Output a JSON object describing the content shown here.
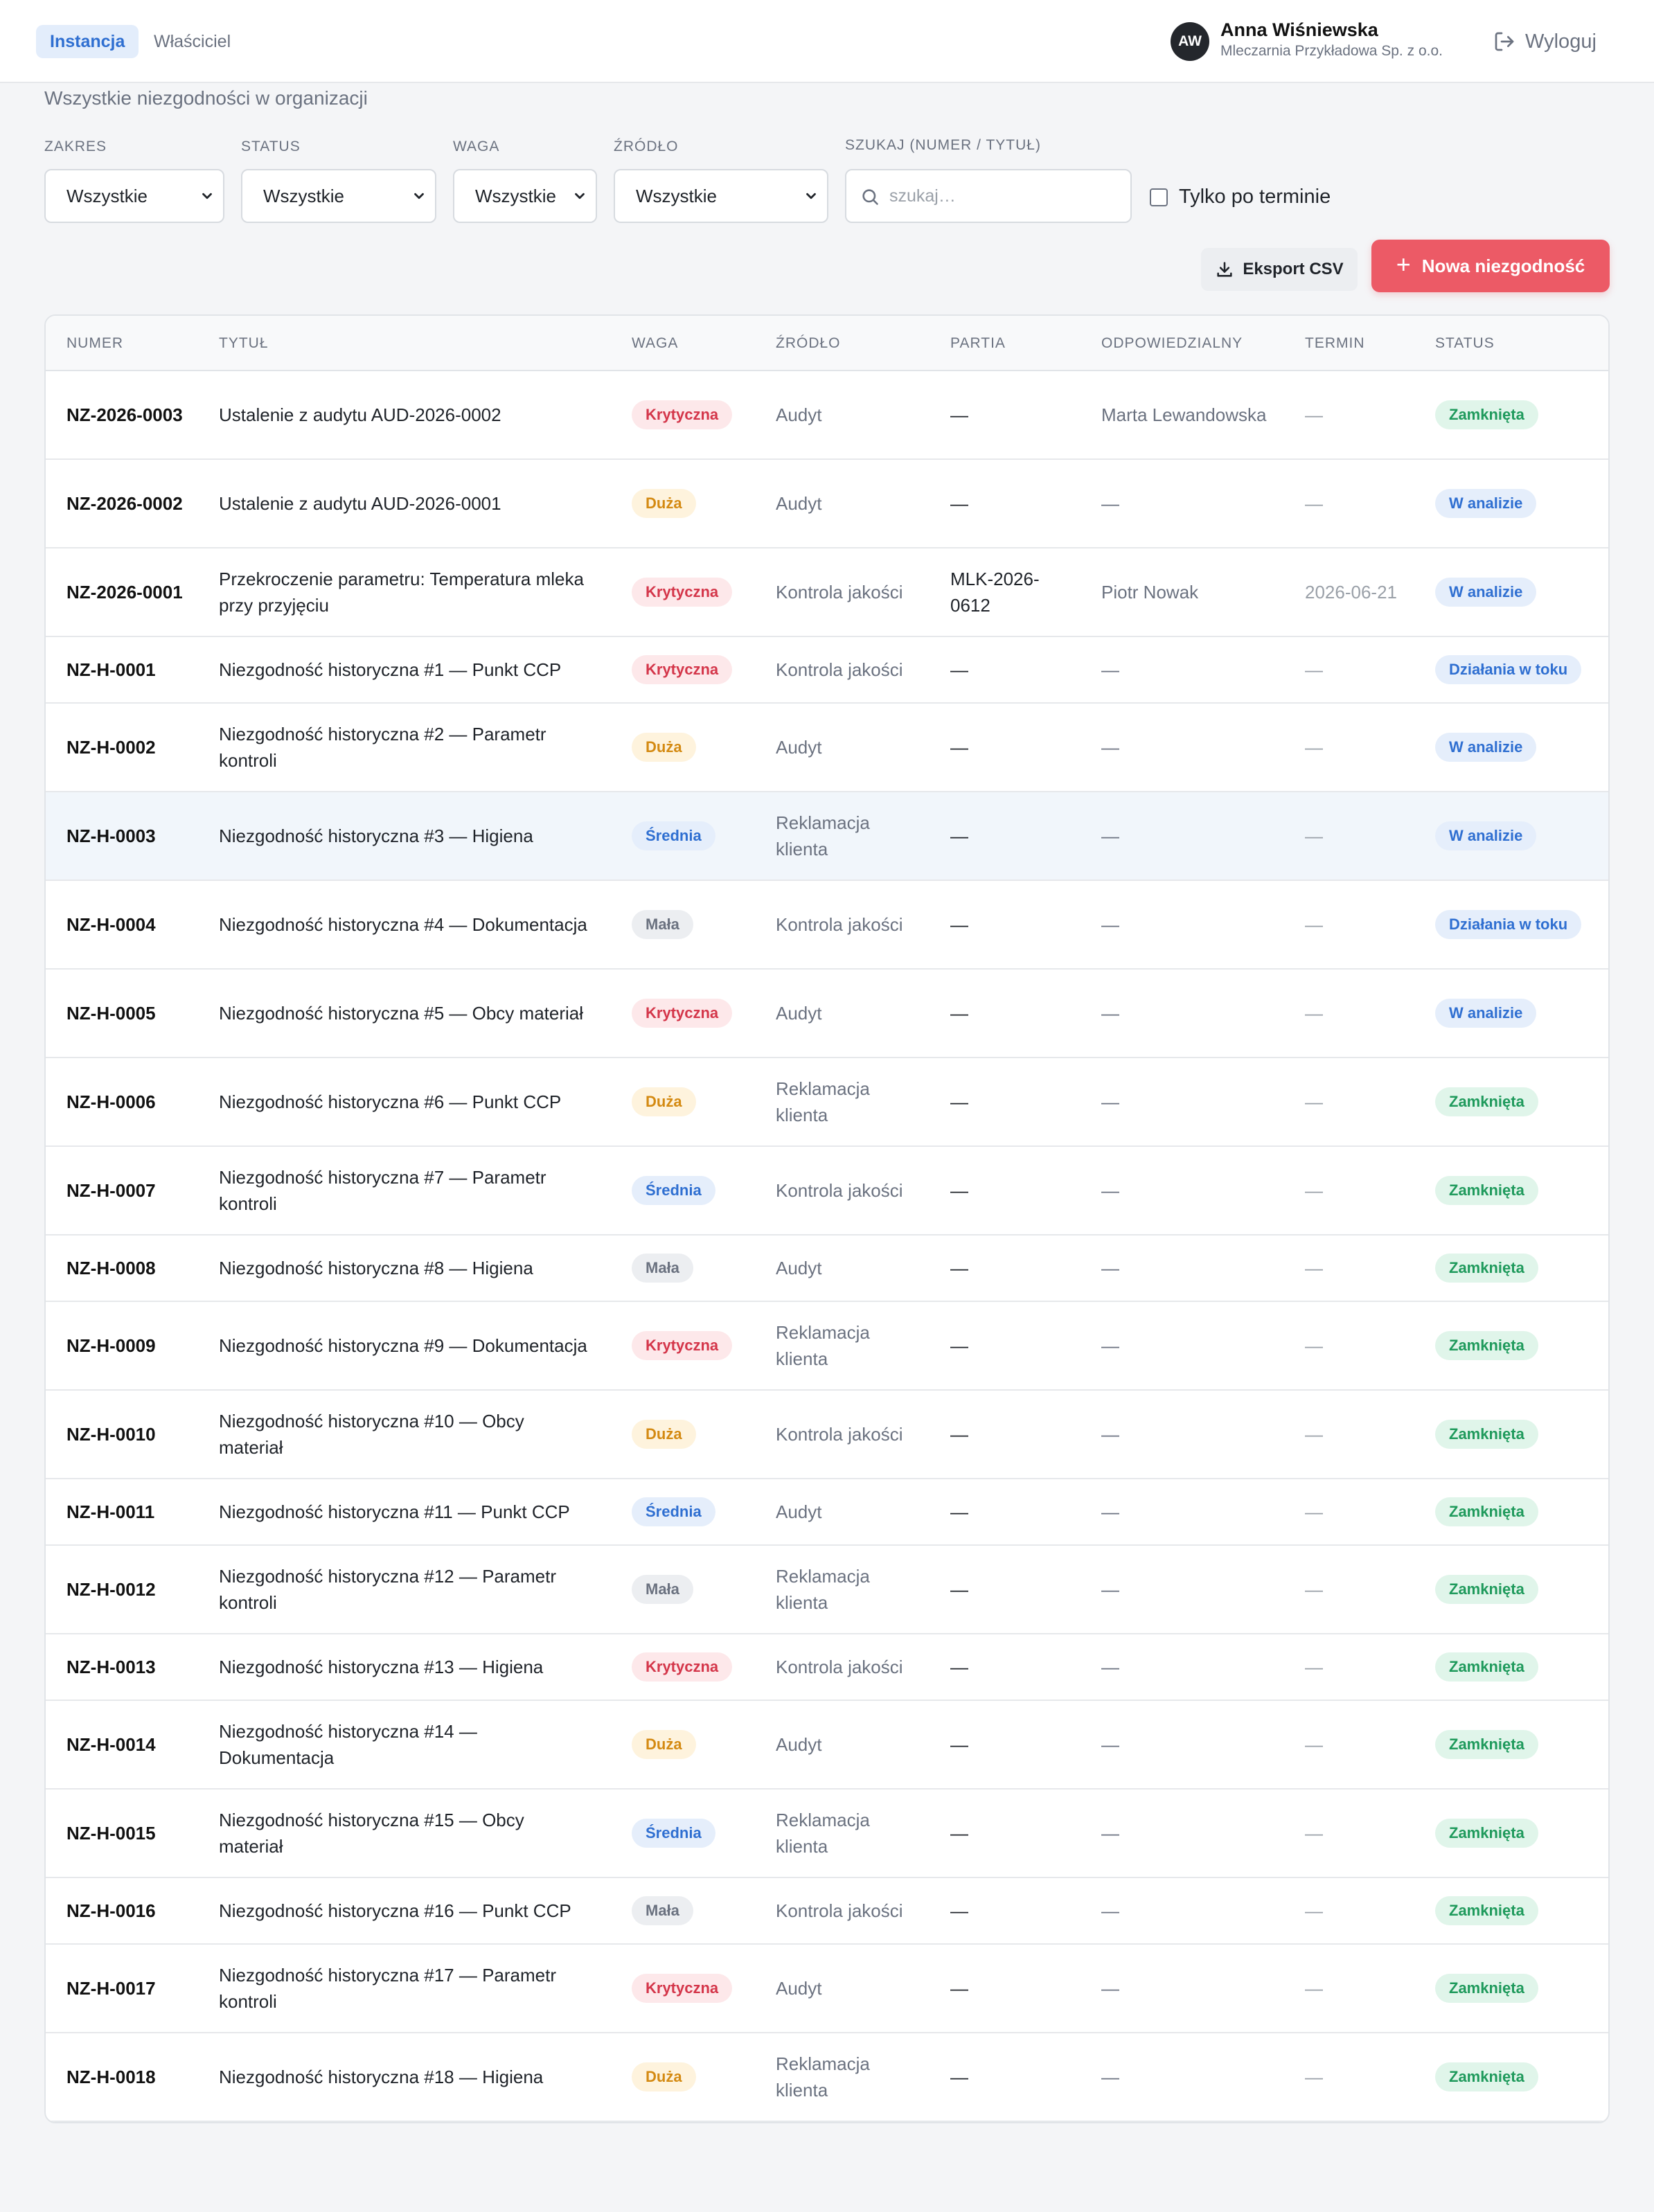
{
  "header": {
    "tabs": [
      {
        "label": "Instancja",
        "active": true
      },
      {
        "label": "Właściciel",
        "active": false
      }
    ],
    "user": {
      "initials": "AW",
      "name": "Anna Wiśniewska",
      "organization": "Mleczarnia Przykładowa Sp. z o.o."
    },
    "logout_label": "Wyloguj"
  },
  "page": {
    "subtitle": "Wszystkie niezgodności w organizacji"
  },
  "filters": {
    "zakres": {
      "label": "ZAKRES",
      "value": "Wszystkie"
    },
    "status": {
      "label": "STATUS",
      "value": "Wszystkie"
    },
    "waga": {
      "label": "WAGA",
      "value": "Wszystkie"
    },
    "zrodlo": {
      "label": "ŹRÓDŁO",
      "value": "Wszystkie"
    },
    "search": {
      "label": "SZUKAJ (NUMER / TYTUŁ)",
      "placeholder": "szukaj…"
    },
    "overdue_only": {
      "label": "Tylko po terminie",
      "checked": false
    }
  },
  "actions": {
    "export_label": "Eksport CSV",
    "new_label": "Nowa niezgodność"
  },
  "table": {
    "columns": [
      "NUMER",
      "TYTUŁ",
      "WAGA",
      "ŹRÓDŁO",
      "PARTIA",
      "ODPOWIEDZIALNY",
      "TERMIN",
      "STATUS"
    ],
    "rows": [
      {
        "numer": "NZ-2026-0003",
        "tytul": "Ustalenie z audytu AUD-2026-0002",
        "waga": "Krytyczna",
        "zrodlo": "Audyt",
        "partia": "—",
        "odpowiedzialny": "Marta Lewandowska",
        "termin": "—",
        "status": "Zamknięta"
      },
      {
        "numer": "NZ-2026-0002",
        "tytul": "Ustalenie z audytu AUD-2026-0001",
        "waga": "Duża",
        "zrodlo": "Audyt",
        "partia": "—",
        "odpowiedzialny": "—",
        "termin": "—",
        "status": "W analizie"
      },
      {
        "numer": "NZ-2026-0001",
        "tytul": "Przekroczenie parametru: Temperatura mleka przy przyjęciu",
        "waga": "Krytyczna",
        "zrodlo": "Kontrola jakości",
        "partia": "MLK-2026-0612",
        "odpowiedzialny": "Piotr Nowak",
        "termin": "2026-06-21",
        "status": "W analizie"
      },
      {
        "numer": "NZ-H-0001",
        "tytul": "Niezgodność historyczna #1 — Punkt CCP",
        "waga": "Krytyczna",
        "zrodlo": "Kontrola jakości",
        "partia": "—",
        "odpowiedzialny": "—",
        "termin": "—",
        "status": "Działania w toku"
      },
      {
        "numer": "NZ-H-0002",
        "tytul": "Niezgodność historyczna #2 — Parametr kontroli",
        "waga": "Duża",
        "zrodlo": "Audyt",
        "partia": "—",
        "odpowiedzialny": "—",
        "termin": "—",
        "status": "W analizie"
      },
      {
        "numer": "NZ-H-0003",
        "tytul": "Niezgodność historyczna #3 — Higiena",
        "waga": "Średnia",
        "zrodlo": "Reklamacja klienta",
        "partia": "—",
        "odpowiedzialny": "—",
        "termin": "—",
        "status": "W analizie"
      },
      {
        "numer": "NZ-H-0004",
        "tytul": "Niezgodność historyczna #4 — Dokumentacja",
        "waga": "Mała",
        "zrodlo": "Kontrola jakości",
        "partia": "—",
        "odpowiedzialny": "—",
        "termin": "—",
        "status": "Działania w toku"
      },
      {
        "numer": "NZ-H-0005",
        "tytul": "Niezgodność historyczna #5 — Obcy materiał",
        "waga": "Krytyczna",
        "zrodlo": "Audyt",
        "partia": "—",
        "odpowiedzialny": "—",
        "termin": "—",
        "status": "W analizie"
      },
      {
        "numer": "NZ-H-0006",
        "tytul": "Niezgodność historyczna #6 — Punkt CCP",
        "waga": "Duża",
        "zrodlo": "Reklamacja klienta",
        "partia": "—",
        "odpowiedzialny": "—",
        "termin": "—",
        "status": "Zamknięta"
      },
      {
        "numer": "NZ-H-0007",
        "tytul": "Niezgodność historyczna #7 — Parametr kontroli",
        "waga": "Średnia",
        "zrodlo": "Kontrola jakości",
        "partia": "—",
        "odpowiedzialny": "—",
        "termin": "—",
        "status": "Zamknięta"
      },
      {
        "numer": "NZ-H-0008",
        "tytul": "Niezgodność historyczna #8 — Higiena",
        "waga": "Mała",
        "zrodlo": "Audyt",
        "partia": "—",
        "odpowiedzialny": "—",
        "termin": "—",
        "status": "Zamknięta"
      },
      {
        "numer": "NZ-H-0009",
        "tytul": "Niezgodność historyczna #9 — Dokumentacja",
        "waga": "Krytyczna",
        "zrodlo": "Reklamacja klienta",
        "partia": "—",
        "odpowiedzialny": "—",
        "termin": "—",
        "status": "Zamknięta"
      },
      {
        "numer": "NZ-H-0010",
        "tytul": "Niezgodność historyczna #10 — Obcy materiał",
        "waga": "Duża",
        "zrodlo": "Kontrola jakości",
        "partia": "—",
        "odpowiedzialny": "—",
        "termin": "—",
        "status": "Zamknięta"
      },
      {
        "numer": "NZ-H-0011",
        "tytul": "Niezgodność historyczna #11 — Punkt CCP",
        "waga": "Średnia",
        "zrodlo": "Audyt",
        "partia": "—",
        "odpowiedzialny": "—",
        "termin": "—",
        "status": "Zamknięta"
      },
      {
        "numer": "NZ-H-0012",
        "tytul": "Niezgodność historyczna #12 — Parametr kontroli",
        "waga": "Mała",
        "zrodlo": "Reklamacja klienta",
        "partia": "—",
        "odpowiedzialny": "—",
        "termin": "—",
        "status": "Zamknięta"
      },
      {
        "numer": "NZ-H-0013",
        "tytul": "Niezgodność historyczna #13 — Higiena",
        "waga": "Krytyczna",
        "zrodlo": "Kontrola jakości",
        "partia": "—",
        "odpowiedzialny": "—",
        "termin": "—",
        "status": "Zamknięta"
      },
      {
        "numer": "NZ-H-0014",
        "tytul": "Niezgodność historyczna #14 — Dokumentacja",
        "waga": "Duża",
        "zrodlo": "Audyt",
        "partia": "—",
        "odpowiedzialny": "—",
        "termin": "—",
        "status": "Zamknięta"
      },
      {
        "numer": "NZ-H-0015",
        "tytul": "Niezgodność historyczna #15 — Obcy materiał",
        "waga": "Średnia",
        "zrodlo": "Reklamacja klienta",
        "partia": "—",
        "odpowiedzialny": "—",
        "termin": "—",
        "status": "Zamknięta"
      },
      {
        "numer": "NZ-H-0016",
        "tytul": "Niezgodność historyczna #16 — Punkt CCP",
        "waga": "Mała",
        "zrodlo": "Kontrola jakości",
        "partia": "—",
        "odpowiedzialny": "—",
        "termin": "—",
        "status": "Zamknięta"
      },
      {
        "numer": "NZ-H-0017",
        "tytul": "Niezgodność historyczna #17 — Parametr kontroli",
        "waga": "Krytyczna",
        "zrodlo": "Audyt",
        "partia": "—",
        "odpowiedzialny": "—",
        "termin": "—",
        "status": "Zamknięta"
      },
      {
        "numer": "NZ-H-0018",
        "tytul": "Niezgodność historyczna #18 — Higiena",
        "waga": "Duża",
        "zrodlo": "Reklamacja klienta",
        "partia": "—",
        "odpowiedzialny": "—",
        "termin": "—",
        "status": "Zamknięta"
      }
    ]
  },
  "colors": {
    "accent": "#ec5a66",
    "tab_active_bg": "#e3edfb",
    "tab_active_text": "#2f6fd1",
    "highlight_row_bg": "#f1f6fb",
    "icons": [
      "logout-icon",
      "search-icon",
      "download-icon",
      "plus-icon",
      "chevron-down-icon"
    ]
  }
}
